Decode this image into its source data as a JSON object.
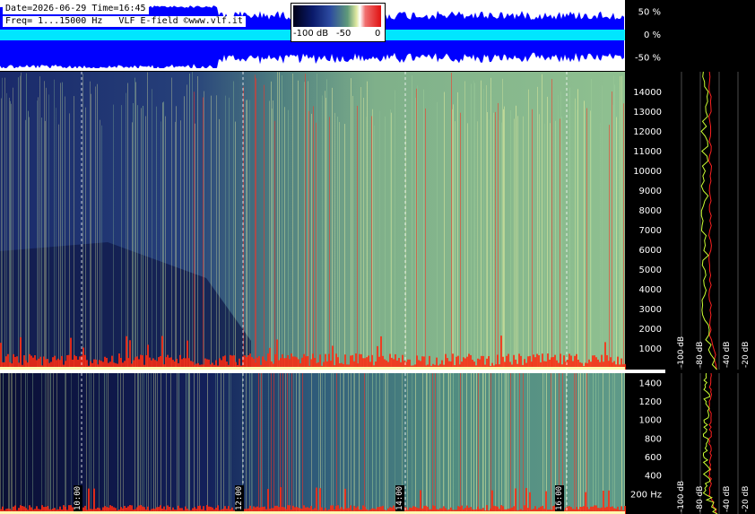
{
  "header": {
    "date_line": "Date=2026-06-29 Time=16:45",
    "freq_line": "Freq= 1...15000 Hz   VLF E-field ©www.vlf.it"
  },
  "intensity_scale": {
    "labels": [
      "-100 dB",
      "-50",
      "0"
    ]
  },
  "colors": {
    "background": "#000000",
    "waveform_fill": "#0000ff",
    "waveform_center": "#00ffff",
    "spectrum_average": "#ccff33",
    "spectrum_peak": "#ff2020",
    "grid": "#808080"
  },
  "chart_data": [
    {
      "type": "area",
      "title": "",
      "description_labels": [
        "50 %",
        "0 %",
        "-50 %"
      ],
      "y_ticks": [
        50,
        0,
        -50
      ],
      "ylim": [
        -75,
        75
      ],
      "series": [
        {
          "values": []
        }
      ]
    },
    {
      "type": "heatmap",
      "xlabel": "",
      "ylabel": "",
      "x_ticks": [
        "10:00",
        "12:00",
        "14:00",
        "16:00"
      ],
      "x_range": [
        "09:05",
        "16:45"
      ],
      "y_ticks": [
        1000,
        2000,
        3000,
        4000,
        5000,
        6000,
        7000,
        8000,
        9000,
        10000,
        11000,
        12000,
        13000,
        14000
      ],
      "ylim": [
        1,
        15000
      ]
    },
    {
      "type": "heatmap",
      "y_ticks": [
        200,
        400,
        600,
        800,
        1000,
        1200,
        1400
      ],
      "y_tick_labels": [
        "200 Hz",
        "400",
        "600",
        "800",
        "1000",
        "1200",
        "1400"
      ],
      "ylim": [
        1,
        1500
      ]
    },
    {
      "type": "line",
      "x_tick_labels": [
        "-100 dB",
        "-80 dB",
        "-40 dB",
        "-20 dB"
      ],
      "series": [
        {
          "values": []
        },
        {
          "values": []
        }
      ]
    },
    {
      "type": "line",
      "x_tick_labels": [
        "-100 dB",
        "-80 dB",
        "-40 dB",
        "-20 dB"
      ],
      "series": [
        {
          "values": []
        },
        {
          "values": []
        }
      ]
    }
  ]
}
